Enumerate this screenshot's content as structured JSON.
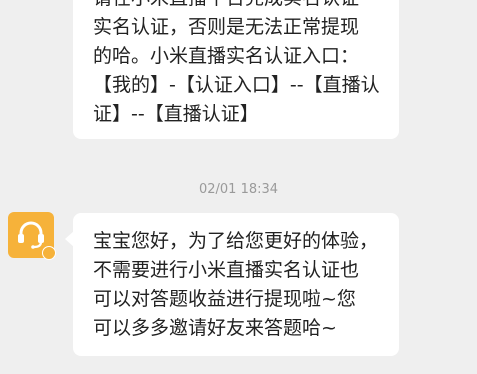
{
  "messages": {
    "first": {
      "lines": [
        "请在小米直播平台完成实名认证",
        "实名认证，否则是无法正常提现",
        "的哈。小米直播实名认证入口：",
        "【我的】-【认证入口】--【直播认",
        "证】--【直播认证】"
      ]
    },
    "timestamp": "02/01 18:34",
    "second": {
      "lines": [
        "宝宝您好，为了给您更好的体验，",
        "不需要进行小米直播实名认证也",
        "可以对答题收益进行提现啦~您",
        "可以多多邀请好友来答题哈~"
      ]
    }
  },
  "avatar": {
    "icon": "headset-icon",
    "badge_icon": "badge-icon",
    "color": "#f6b23a"
  },
  "colors": {
    "background": "#efefef",
    "bubble": "#ffffff",
    "text": "#222222",
    "timestamp": "#9a9a9a"
  }
}
